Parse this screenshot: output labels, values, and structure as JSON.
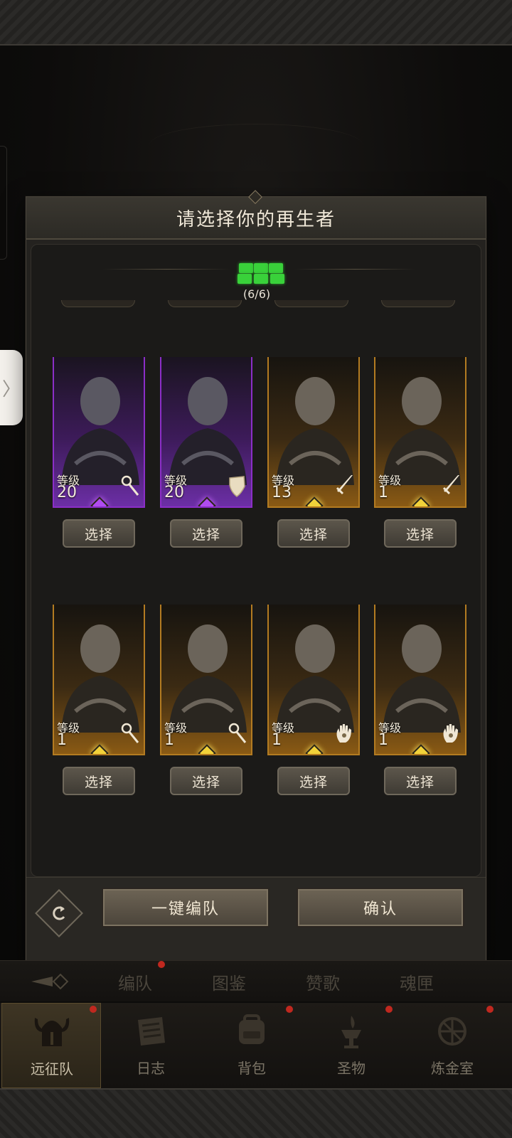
{
  "modal": {
    "title": "请选择你的再生者",
    "team_count": "(6/6)"
  },
  "heroes": [
    {
      "level_label": "等级",
      "level": "20",
      "rarity": "epic",
      "class_icon": "staff-icon",
      "select_label": "选择"
    },
    {
      "level_label": "等级",
      "level": "20",
      "rarity": "epic",
      "class_icon": "shield-icon",
      "select_label": "选择"
    },
    {
      "level_label": "等级",
      "level": "13",
      "rarity": "legendary",
      "class_icon": "sword-icon",
      "select_label": "选择"
    },
    {
      "level_label": "等级",
      "level": "1",
      "rarity": "legendary",
      "class_icon": "sword-icon",
      "select_label": "选择"
    },
    {
      "level_label": "等级",
      "level": "1",
      "rarity": "legendary",
      "class_icon": "staff-icon",
      "select_label": "选择"
    },
    {
      "level_label": "等级",
      "level": "1",
      "rarity": "legendary",
      "class_icon": "staff-icon",
      "select_label": "选择"
    },
    {
      "level_label": "等级",
      "level": "1",
      "rarity": "legendary",
      "class_icon": "hand-icon",
      "select_label": "选择"
    },
    {
      "level_label": "等级",
      "level": "1",
      "rarity": "legendary",
      "class_icon": "hand-icon",
      "select_label": "选择"
    }
  ],
  "footer": {
    "auto_team_label": "一键编队",
    "confirm_label": "确认"
  },
  "sub_tabs": [
    "编队",
    "图鉴",
    "赞歌",
    "魂匣"
  ],
  "bottom_nav": [
    {
      "label": "远征队",
      "icon": "horned-helmet-icon",
      "active": true
    },
    {
      "label": "日志",
      "icon": "scroll-icon",
      "active": false
    },
    {
      "label": "背包",
      "icon": "backpack-icon",
      "active": false
    },
    {
      "label": "圣物",
      "icon": "brazier-icon",
      "active": false
    },
    {
      "label": "炼金室",
      "icon": "alchemy-icon",
      "active": false
    }
  ],
  "colors": {
    "epic": "#8b2ec7",
    "legendary": "#b37b21",
    "team_indicator": "#39d13a",
    "notification": "#c0281f"
  }
}
